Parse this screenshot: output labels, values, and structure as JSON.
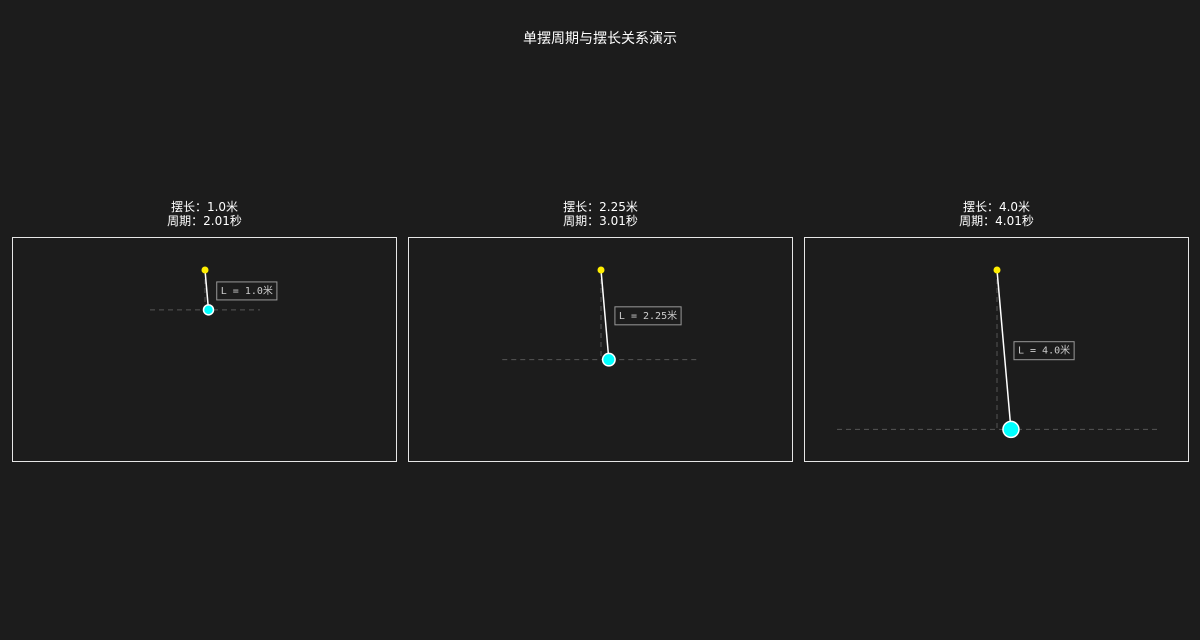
{
  "title": "单摆周期与摆长关系演示",
  "panels": [
    {
      "length_line": "摆长：1.0米",
      "period_line": "周期：2.01秒",
      "rod_label": "L = 1.0米",
      "length_m": 1.0,
      "period_s": 2.01
    },
    {
      "length_line": "摆长：2.25米",
      "period_line": "周期：3.01秒",
      "rod_label": "L = 2.25米",
      "length_m": 2.25,
      "period_s": 3.01
    },
    {
      "length_line": "摆长：4.0米",
      "period_line": "周期：4.01秒",
      "rod_label": "L = 4.0米",
      "length_m": 4.0,
      "period_s": 4.01
    }
  ],
  "colors": {
    "background": "#1c1c1c",
    "pivot": "#ffee00",
    "bob": "#00ffff",
    "rod": "#ffffff",
    "guide": "#555555",
    "frame": "#e6e6e6"
  }
}
